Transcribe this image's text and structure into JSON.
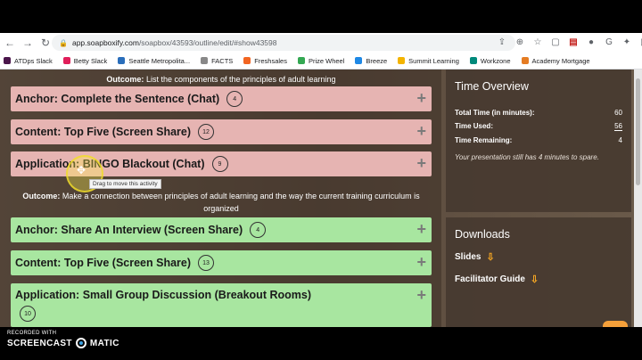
{
  "browser": {
    "url_host": "app.soapboxify.com",
    "url_path": "/soapbox/43593/outline/edit/#show43598"
  },
  "bookmarks": [
    {
      "label": "ATDps Slack",
      "color": "#4a154b"
    },
    {
      "label": "Betty Slack",
      "color": "#e01e5a"
    },
    {
      "label": "Seattle Metropolita...",
      "color": "#2a6ebb"
    },
    {
      "label": "FACTS",
      "color": "#888888"
    },
    {
      "label": "Freshsales",
      "color": "#f26522"
    },
    {
      "label": "Prize Wheel",
      "color": "#34a853"
    },
    {
      "label": "Breeze",
      "color": "#1e88e5"
    },
    {
      "label": "Summit Learning",
      "color": "#f4b400"
    },
    {
      "label": "Workzone",
      "color": "#00897b"
    },
    {
      "label": "Academy Mortgage",
      "color": "#e57c23"
    }
  ],
  "outline": {
    "outcome1": {
      "label": "Outcome:",
      "text": "List the components of the principles of adult learning"
    },
    "outcome2": {
      "label": "Outcome:",
      "text": "Make a connection between principles of adult learning and the way the current training curriculum is organized"
    },
    "activities": [
      {
        "title": "Anchor: Complete the Sentence (Chat)",
        "minutes": "4"
      },
      {
        "title": "Content: Top Five (Screen Share)",
        "minutes": "12"
      },
      {
        "title": "Application: BINGO Blackout (Chat)",
        "minutes": "9"
      },
      {
        "title": "Anchor: Share An Interview (Screen Share)",
        "minutes": "4"
      },
      {
        "title": "Content: Top Five (Screen Share)",
        "minutes": "13"
      },
      {
        "title": "Application: Small Group Discussion (Breakout Rooms)",
        "minutes": "10"
      }
    ],
    "tooltip": "Drag to move this activity"
  },
  "time_overview": {
    "title": "Time Overview",
    "total_label": "Total Time (in minutes):",
    "total_value": "60",
    "used_label": "Time Used:",
    "used_value": "56",
    "remaining_label": "Time Remaining:",
    "remaining_value": "4",
    "note": "Your presentation still has 4 minutes to spare."
  },
  "downloads": {
    "title": "Downloads",
    "slides": "Slides",
    "guide": "Facilitator Guide"
  },
  "watermark": {
    "recorded": "RECORDED WITH",
    "brand_left": "SCREENCAST",
    "brand_right": "MATIC"
  }
}
